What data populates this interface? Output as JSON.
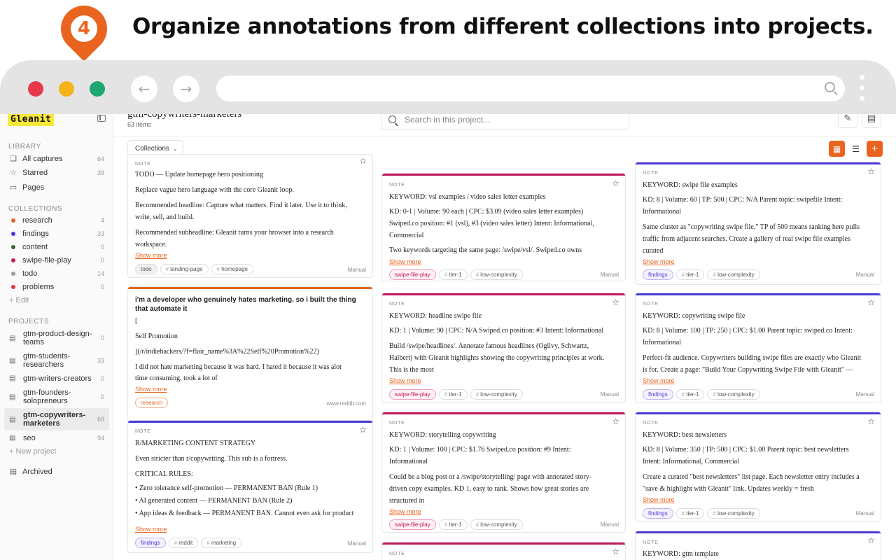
{
  "banner": {
    "step": "4",
    "title": "Organize annotations from different collections into projects."
  },
  "app": {
    "brand": "Gleanit",
    "library": {
      "label": "LIBRARY",
      "items": [
        {
          "label": "All captures",
          "count": "64",
          "icon": "layers-icon"
        },
        {
          "label": "Starred",
          "count": "39",
          "icon": "star-icon"
        },
        {
          "label": "Pages",
          "count": "",
          "icon": "pages-icon"
        }
      ]
    },
    "collections": {
      "label": "COLLECTIONS",
      "items": [
        {
          "label": "research",
          "count": "4",
          "color": "#e8641f"
        },
        {
          "label": "findings",
          "count": "33",
          "color": "#4b3bd6"
        },
        {
          "label": "content",
          "count": "0",
          "color": "#2e6b2f"
        },
        {
          "label": "swipe-file-play",
          "count": "0",
          "color": "#c2185b"
        },
        {
          "label": "todo",
          "count": "14",
          "color": "#9e9e9e"
        },
        {
          "label": "problems",
          "count": "0",
          "color": "#e53935"
        }
      ],
      "edit": "+ Edit"
    },
    "projects": {
      "label": "PROJECTS",
      "items": [
        {
          "label": "gtm-product-design-teams",
          "count": "0"
        },
        {
          "label": "gtm-students-researchers",
          "count": "33"
        },
        {
          "label": "gtm-writers-creators",
          "count": "0"
        },
        {
          "label": "gtm-founders-solopreneurs",
          "count": "0"
        },
        {
          "label": "gtm-copywriters-marketers",
          "count": "68"
        },
        {
          "label": "seo",
          "count": "94"
        }
      ],
      "new": "+ New project",
      "archived": "Archived"
    },
    "header": {
      "title": "gtm-copywriters-marketers",
      "count": "63 items",
      "search_placeholder": "Search in this project...",
      "collections_label": "Collections"
    },
    "colors": {
      "accent": "#e8641f"
    }
  },
  "cards": {
    "c1": {
      "kind": "NOTE",
      "title": "TODO — Update homepage hero positioning",
      "lines": [
        "Replace vague hero language with the core Gleanit loop.",
        "Recommended headline: Capture what matters. Find it later. Use it to think,",
        "write, sell, and build.",
        "Recommended subheadline: Gleanit turns your browser into a research",
        "workspace."
      ],
      "more": "Show more",
      "tags": [
        "todo",
        "landing-page",
        "homepage"
      ],
      "source": "Manual"
    },
    "c2": {
      "title": "i'm a developer who genuinely hates marketing. so i built the thing that automate it",
      "lines": [
        "[",
        "Self Promotion",
        "](/r/indiehackers/?f=flair_name%3A%22Self%20Promotion%22)",
        "I did not hate marketing because it was hard. I hated it because it was alot",
        "time consuming, took a lot of"
      ],
      "more": "Show more",
      "tags": [
        "research"
      ],
      "source": "www.reddit.com"
    },
    "c3": {
      "kind": "NOTE",
      "title": "R/MARKETING CONTENT STRATEGY",
      "lines": [
        "Even stricter than r/copywriting. This sub is a fortress.",
        "CRITICAL RULES:"
      ],
      "bullets": [
        "Zero tolerance self-promotion — PERMANENT BAN (Rule 1)",
        "AI generated content — PERMANENT BAN (Rule 2)",
        "App ideas & feedback — PERMANENT BAN. Cannot even ask for product"
      ],
      "more": "Show more",
      "tags": [
        "findings",
        "reddit",
        "marketing"
      ],
      "source": "Manual"
    },
    "c4": {
      "kind": "NOTE",
      "title": "KEYWORD: vsl examples / video sales letter examples",
      "lines": [
        "KD: 0-1 | Volume: 90 each | CPC: $3.09 (video sales letter examples)",
        "Swiped.co position: #1 (vsl), #3 (video sales letter) Intent: Informational,",
        "Commercial",
        "Two keywords targeting the same page: /swipe/vsl/. Swiped.co owns"
      ],
      "more": "Show more",
      "tags": [
        "swipe-file-play",
        "tier-1",
        "low-complexity"
      ],
      "source": "Manual"
    },
    "c5": {
      "kind": "NOTE",
      "title": "KEYWORD: headline swipe file",
      "lines": [
        "KD: 1 | Volume: 90 | CPC: N/A Swiped.co position: #3 Intent: Informational",
        "Build /swipe/headlines/. Annotate famous headlines (Ogilvy, Schwartz,",
        "Halbert) with Gleanit highlights showing the copywriting principles at work.",
        "This is the most"
      ],
      "more": "Show more",
      "tags": [
        "swipe-file-play",
        "tier-1",
        "low-complexity"
      ],
      "source": "Manual"
    },
    "c6": {
      "kind": "NOTE",
      "title": "KEYWORD: storytelling copywriting",
      "lines": [
        "KD: 1 | Volume: 100 | CPC: $1.76 Swiped.co position: #9 Intent:",
        "Informational",
        "Could be a blog post or a /swipe/storytelling/ page with annotated story-",
        "driven copy examples. KD 1, easy to rank. Shows how great stories are",
        "structured in"
      ],
      "more": "Show more",
      "tags": [
        "swipe-file-play",
        "tier-1",
        "low-complexity"
      ],
      "source": "Manual"
    },
    "c7": {
      "kind": "NOTE"
    },
    "c8": {
      "kind": "NOTE",
      "title": "KEYWORD: swipe file examples",
      "lines": [
        "KD: 8 | Volume: 60 | TP: 500 | CPC: N/A Parent topic: swipefile Intent:",
        "Informational",
        "Same cluster as \"copywriting swipe file.\" TP of 500 means ranking here pulls",
        "traffic from adjacent searches. Create a gallery of real swipe file examples",
        "curated"
      ],
      "more": "Show more",
      "tags": [
        "findings",
        "tier-1",
        "low-complexity"
      ],
      "source": "Manual"
    },
    "c9": {
      "kind": "NOTE",
      "title": "KEYWORD: copywriting swipe file",
      "lines": [
        "KD: 8 | Volume: 100 | TP: 250 | CPC: $1.00 Parent topic: swiped.co Intent:",
        "Informational",
        "Perfect-fit audience. Copywriters building swipe files are exactly who Gleanit",
        "is for. Create a page: \"Build Your Copywriting Swipe File with Gleanit\" —"
      ],
      "more": "Show more",
      "tags": [
        "findings",
        "tier-1",
        "low-complexity"
      ],
      "source": "Manual"
    },
    "c10": {
      "kind": "NOTE",
      "title": "KEYWORD: best newsletters",
      "lines": [
        "KD: 8 | Volume: 350 | TP: 500 | CPC: $1.00 Parent topic: best newsletters",
        "Intent: Informational, Commercial",
        "Create a curated \"best newsletters\" list page. Each newsletter entry includes a",
        "\"save & highlight with Gleanit\" link. Updates weekly = fresh"
      ],
      "more": "Show more",
      "tags": [
        "findings",
        "tier-1",
        "low-complexity"
      ],
      "source": "Manual"
    },
    "c11": {
      "kind": "NOTE",
      "title": "KEYWORD: gtm template"
    }
  }
}
